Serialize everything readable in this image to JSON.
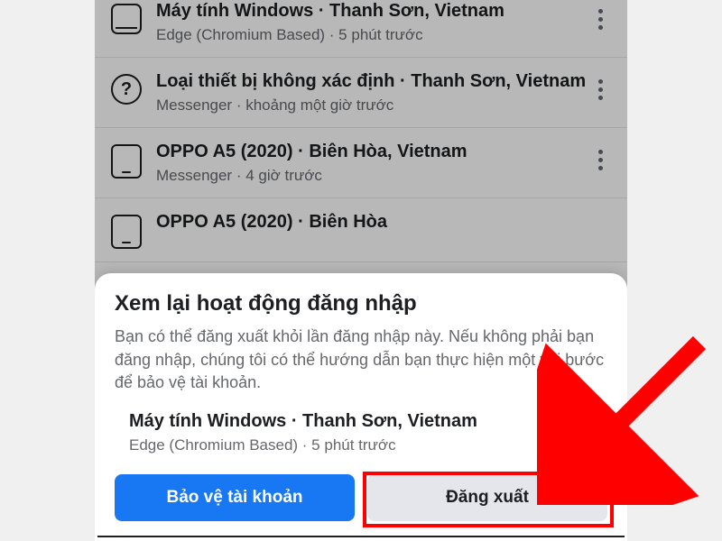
{
  "sessions": [
    {
      "title": "Máy tính Windows · Thanh Sơn, Vietnam",
      "sub": "Edge (Chromium Based) · 5 phút trước",
      "icon": "monitor"
    },
    {
      "title": "Loại thiết bị không xác định · Thanh Sơn, Vietnam",
      "sub": "Messenger · khoảng một giờ trước",
      "icon": "unknown"
    },
    {
      "title": "OPPO A5 (2020) · Biên Hòa, Vietnam",
      "sub": "Messenger · 4 giờ trước",
      "icon": "mobile"
    },
    {
      "title": "OPPO A5 (2020) · Biên Hòa",
      "sub": "",
      "icon": "mobile"
    }
  ],
  "sheet": {
    "title": "Xem lại hoạt động đăng nhập",
    "description": "Bạn có thể đăng xuất khỏi lần đăng nhập này. Nếu không phải bạn đăng nhập, chúng tôi có thể hướng dẫn bạn thực hiện một vài bước để bảo vệ tài khoản.",
    "session": {
      "title": "Máy tính Windows · Thanh Sơn, Vietnam",
      "sub": "Edge (Chromium Based) · 5 phút trước"
    },
    "protect_label": "Bảo vệ tài khoản",
    "logout_label": "Đăng xuất"
  }
}
